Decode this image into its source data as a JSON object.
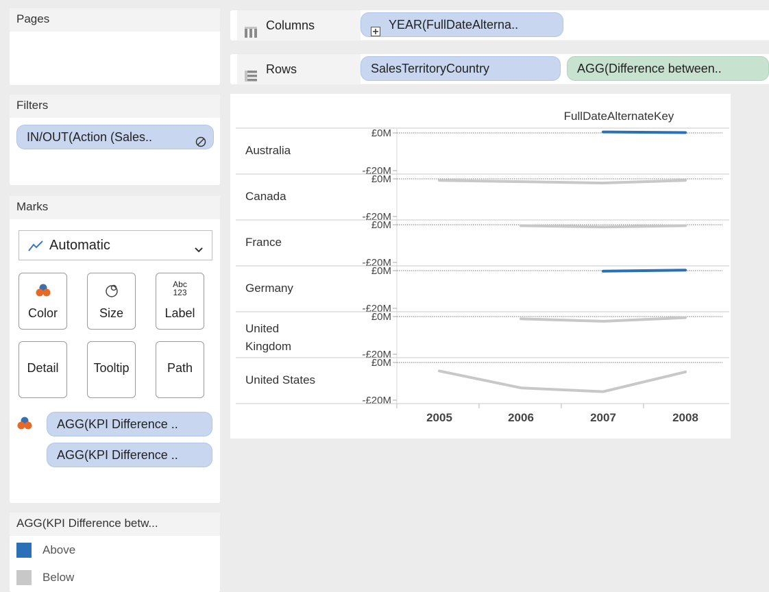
{
  "pages": {
    "title": "Pages"
  },
  "filters": {
    "title": "Filters",
    "items": [
      {
        "label": "IN/OUT(Action (Sales.."
      }
    ]
  },
  "marks": {
    "title": "Marks",
    "mark_type": "Automatic",
    "buttons": {
      "color": "Color",
      "size": "Size",
      "label": "Label",
      "detail": "Detail",
      "tooltip": "Tooltip",
      "path": "Path"
    },
    "label_icon_text": {
      "top": "Abc",
      "bottom": "123"
    },
    "fields": [
      "AGG(KPI Difference ..",
      "AGG(KPI Difference .."
    ]
  },
  "legend": {
    "title": "AGG(KPI Difference betw...",
    "items": [
      {
        "label": "Above",
        "color": "#2a70b7"
      },
      {
        "label": "Below",
        "color": "#c8c8c8"
      }
    ]
  },
  "shelves": {
    "columns": {
      "label": "Columns",
      "pill": "YEAR(FullDateAlterna.."
    },
    "rows": {
      "label": "Rows",
      "pills": [
        "SalesTerritoryCountry",
        "AGG(Difference between.."
      ]
    }
  },
  "viz": {
    "header": "FullDateAlternateKey",
    "axis_ticks": {
      "top": "£0M",
      "bottom": "-£20M"
    }
  },
  "chart_data": {
    "type": "line",
    "x": [
      2005,
      2006,
      2007,
      2008
    ],
    "xlabel": "FullDateAlternateKey",
    "ylim": [
      -20,
      0
    ],
    "y_unit": "£M",
    "colors": {
      "Above": "#2a70b7",
      "Below": "#c8c8c8"
    },
    "series": [
      {
        "name": "Australia",
        "segments": [
          {
            "x": [
              2007,
              2008
            ],
            "y": [
              0.5,
              0.2
            ],
            "kpi": "Above"
          }
        ]
      },
      {
        "name": "Canada",
        "segments": [
          {
            "x": [
              2005,
              2006,
              2007,
              2008
            ],
            "y": [
              -0.8,
              -1.5,
              -2.2,
              -0.8
            ],
            "kpi": "Below"
          }
        ]
      },
      {
        "name": "France",
        "segments": [
          {
            "x": [
              2006,
              2007,
              2008
            ],
            "y": [
              -0.5,
              -1.2,
              -0.5
            ],
            "kpi": "Below"
          }
        ]
      },
      {
        "name": "Germany",
        "segments": [
          {
            "x": [
              2007,
              2008
            ],
            "y": [
              -0.3,
              0.3
            ],
            "kpi": "Above"
          }
        ]
      },
      {
        "name": "United Kingdom",
        "segments": [
          {
            "x": [
              2006,
              2007,
              2008
            ],
            "y": [
              -1.2,
              -2.5,
              -0.6
            ],
            "kpi": "Below"
          }
        ]
      },
      {
        "name": "United States",
        "segments": [
          {
            "x": [
              2005,
              2006,
              2007,
              2008
            ],
            "y": [
              -4.5,
              -13.5,
              -15.5,
              -5.0
            ],
            "kpi": "Below"
          }
        ]
      }
    ]
  }
}
